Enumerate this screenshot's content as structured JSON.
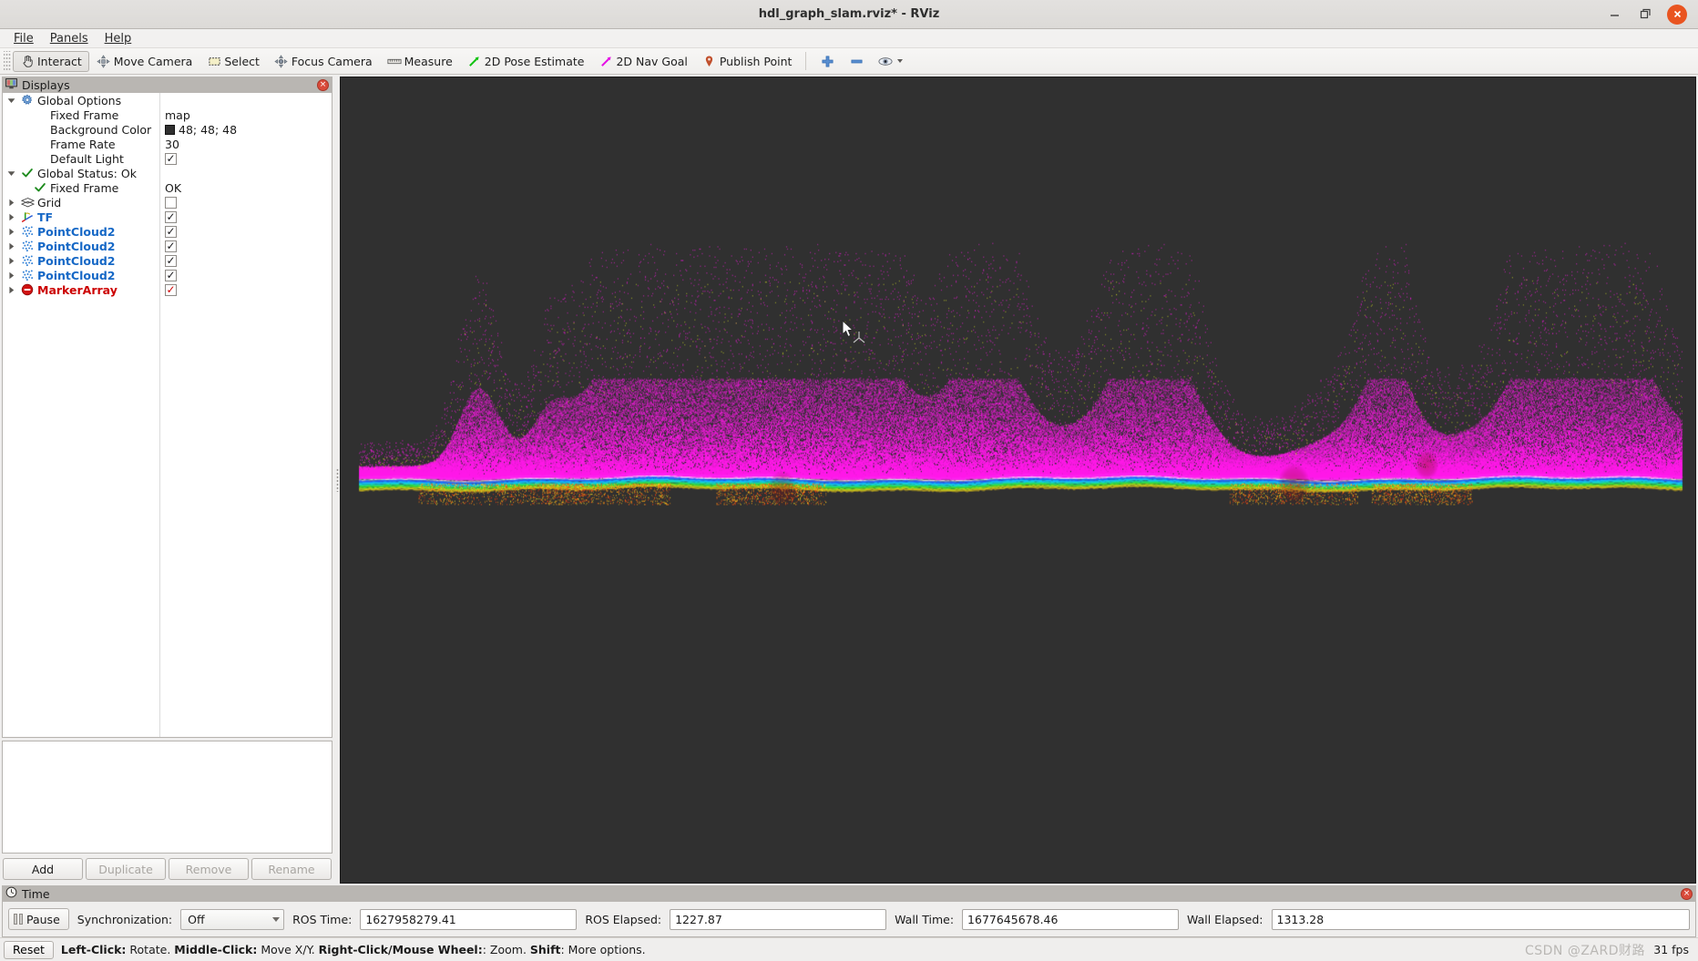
{
  "window": {
    "title": "hdl_graph_slam.rviz* - RViz",
    "minimize_label": "minimize-window",
    "maximize_label": "maximize-window",
    "close_label": "close-window"
  },
  "menubar": {
    "items": [
      {
        "label": "File",
        "mnemonic": "F"
      },
      {
        "label": "Panels",
        "mnemonic": "P"
      },
      {
        "label": "Help",
        "mnemonic": "H"
      }
    ]
  },
  "toolbar": {
    "tools": [
      {
        "label": "Interact",
        "icon": "hand-pointer-icon",
        "active": true
      },
      {
        "label": "Move Camera",
        "icon": "move-camera-icon",
        "active": false
      },
      {
        "label": "Select",
        "icon": "select-rectangle-icon",
        "active": false
      },
      {
        "label": "Focus Camera",
        "icon": "focus-camera-icon",
        "active": false
      },
      {
        "label": "Measure",
        "icon": "ruler-icon",
        "active": false
      },
      {
        "label": "2D Pose Estimate",
        "icon": "green-arrow-icon",
        "active": false
      },
      {
        "label": "2D Nav Goal",
        "icon": "magenta-arrow-icon",
        "active": false
      },
      {
        "label": "Publish Point",
        "icon": "map-pin-icon",
        "active": false
      }
    ],
    "actions": [
      {
        "label": "Add tool",
        "icon": "plus-icon"
      },
      {
        "label": "Remove tool",
        "icon": "minus-icon"
      },
      {
        "label": "Tool properties",
        "icon": "eye-icon"
      }
    ]
  },
  "displays_panel": {
    "title": "Displays",
    "close_label": "×",
    "tree": [
      {
        "indent": 0,
        "twisty": "down",
        "icon": "gear-icon",
        "label": "Global Options",
        "style": "plain",
        "value_type": "none"
      },
      {
        "indent": 1,
        "twisty": "none",
        "icon": "none",
        "label": "Fixed Frame",
        "style": "plain",
        "value_type": "text",
        "value": "map"
      },
      {
        "indent": 1,
        "twisty": "none",
        "icon": "none",
        "label": "Background Color",
        "style": "plain",
        "value_type": "color",
        "value": "48; 48; 48",
        "swatch": "#303030"
      },
      {
        "indent": 1,
        "twisty": "none",
        "icon": "none",
        "label": "Frame Rate",
        "style": "plain",
        "value_type": "text",
        "value": "30"
      },
      {
        "indent": 1,
        "twisty": "none",
        "icon": "none",
        "label": "Default Light",
        "style": "plain",
        "value_type": "checkbox",
        "checked": true,
        "check_color": "dark"
      },
      {
        "indent": 0,
        "twisty": "down",
        "icon": "green-check-icon",
        "label": "Global Status: Ok",
        "style": "plain",
        "value_type": "none"
      },
      {
        "indent": 1,
        "twisty": "none",
        "icon": "green-check-icon",
        "label": "Fixed Frame",
        "style": "plain",
        "value_type": "text",
        "value": "OK"
      },
      {
        "indent": 0,
        "twisty": "right",
        "icon": "grid-icon",
        "label": "Grid",
        "style": "plain",
        "value_type": "checkbox",
        "checked": false,
        "check_color": "dark"
      },
      {
        "indent": 0,
        "twisty": "right",
        "icon": "tf-axes-icon",
        "label": "TF",
        "style": "blue",
        "value_type": "checkbox",
        "checked": true,
        "check_color": "dark"
      },
      {
        "indent": 0,
        "twisty": "right",
        "icon": "pointcloud-icon",
        "label": "PointCloud2",
        "style": "blue",
        "value_type": "checkbox",
        "checked": true,
        "check_color": "dark"
      },
      {
        "indent": 0,
        "twisty": "right",
        "icon": "pointcloud-icon",
        "label": "PointCloud2",
        "style": "blue",
        "value_type": "checkbox",
        "checked": true,
        "check_color": "dark"
      },
      {
        "indent": 0,
        "twisty": "right",
        "icon": "pointcloud-icon",
        "label": "PointCloud2",
        "style": "blue",
        "value_type": "checkbox",
        "checked": true,
        "check_color": "dark"
      },
      {
        "indent": 0,
        "twisty": "right",
        "icon": "pointcloud-icon",
        "label": "PointCloud2",
        "style": "blue",
        "value_type": "checkbox",
        "checked": true,
        "check_color": "dark"
      },
      {
        "indent": 0,
        "twisty": "right",
        "icon": "error-circle-icon",
        "label": "MarkerArray",
        "style": "red",
        "value_type": "checkbox",
        "checked": true,
        "check_color": "red"
      }
    ],
    "buttons": [
      {
        "label": "Add",
        "enabled": true
      },
      {
        "label": "Duplicate",
        "enabled": false
      },
      {
        "label": "Remove",
        "enabled": false
      },
      {
        "label": "Rename",
        "enabled": false
      }
    ]
  },
  "viewport": {
    "background_color": "#303030",
    "name": "3d-render-view"
  },
  "time_panel": {
    "title": "Time",
    "pause_label": "Pause",
    "sync_label": "Synchronization:",
    "sync_value": "Off",
    "fields": [
      {
        "label": "ROS Time:",
        "value": "1627958279.41"
      },
      {
        "label": "ROS Elapsed:",
        "value": "1227.87"
      },
      {
        "label": "Wall Time:",
        "value": "1677645678.46"
      },
      {
        "label": "Wall Elapsed:",
        "value": "1313.28"
      }
    ]
  },
  "statusbar": {
    "reset_label": "Reset",
    "hints": [
      {
        "bold": "Left-Click:",
        "text": " Rotate. "
      },
      {
        "bold": "Middle-Click:",
        "text": " Move X/Y. "
      },
      {
        "bold": "Right-Click/Mouse Wheel:",
        "text": ": Zoom. "
      },
      {
        "bold": "Shift",
        "text": ": More options."
      }
    ],
    "fps": "31 fps",
    "watermark": "CSDN @ZARD财路"
  }
}
